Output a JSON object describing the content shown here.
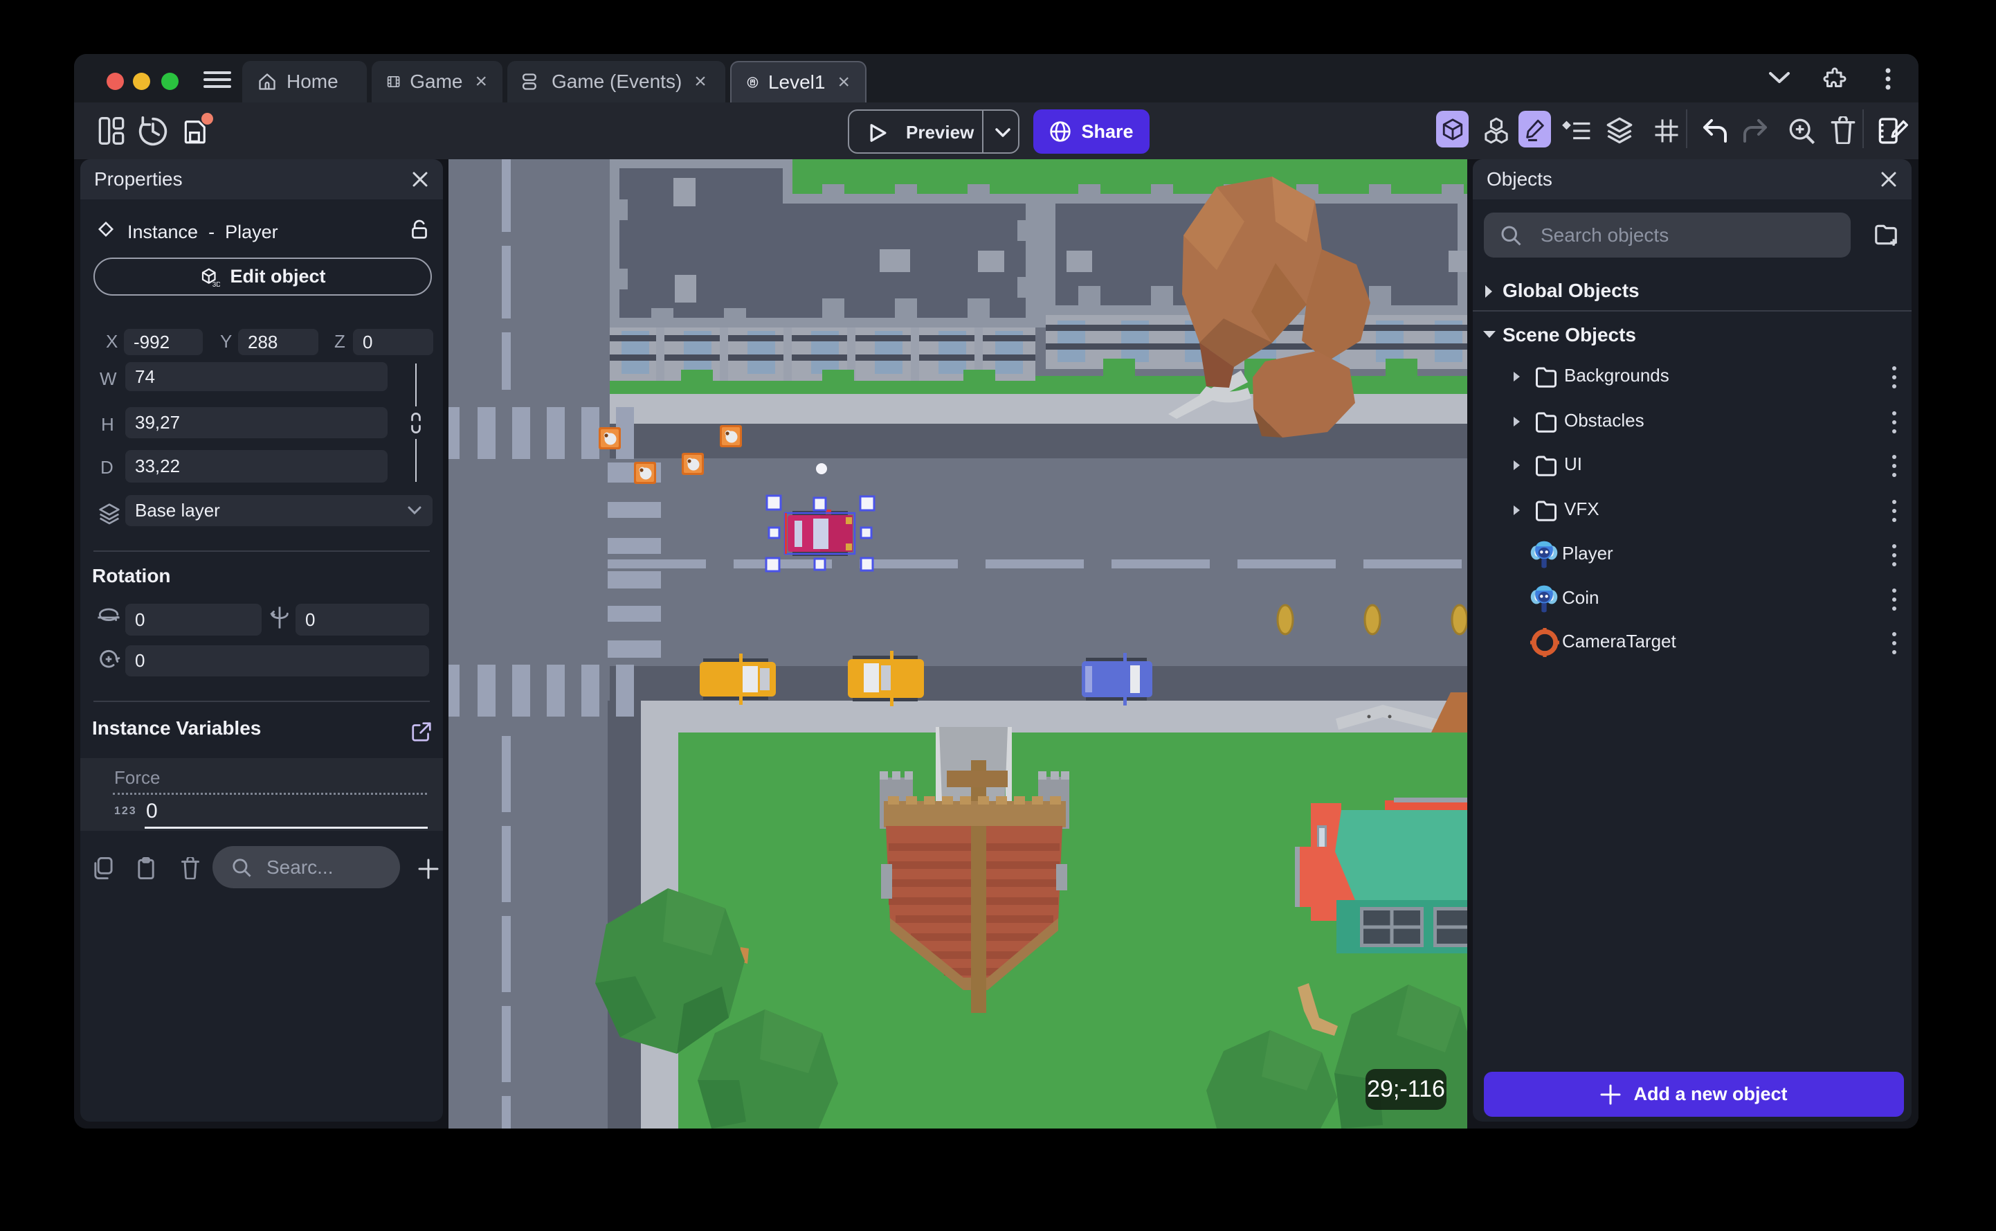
{
  "tabs": [
    {
      "label": "Home"
    },
    {
      "label": "Game",
      "close": "×"
    },
    {
      "label": "Game (Events)",
      "close": "×"
    },
    {
      "label": "Level1",
      "close": "×"
    }
  ],
  "toolbar": {
    "preview_label": "Preview",
    "share_label": "Share"
  },
  "properties_panel": {
    "title": "Properties",
    "instance_label": "Instance",
    "separator": "-",
    "instance_object": "Player",
    "edit_object_label": "Edit object",
    "x_label": "X",
    "x_value": "-992",
    "y_label": "Y",
    "y_value": "288",
    "z_label": "Z",
    "z_value": "0",
    "w_label": "W",
    "w_value": "74",
    "h_label": "H",
    "h_value": "39,27",
    "d_label": "D",
    "d_value": "33,22",
    "layer_value": "Base layer",
    "rotation_title": "Rotation",
    "rotation_x": "0",
    "rotation_y": "0",
    "rotation_z": "0",
    "variables_title": "Instance Variables",
    "variable_name": "Force",
    "variable_type": "123",
    "variable_value": "0",
    "search_placeholder": "Searc..."
  },
  "objects_panel": {
    "title": "Objects",
    "search_placeholder": "Search objects",
    "global_group": "Global Objects",
    "scene_group": "Scene Objects",
    "folders": [
      "Backgrounds",
      "Obstacles",
      "UI",
      "VFX"
    ],
    "objects": [
      "Player",
      "Coin",
      "CameraTarget"
    ],
    "add_button": "Add a new object"
  },
  "canvas": {
    "coordinates_badge": "29;-116"
  },
  "colors": {
    "accent": "#4b2be0",
    "selection": "#4a53e8",
    "grass": "#4aa44d",
    "road": "#6e7483"
  }
}
